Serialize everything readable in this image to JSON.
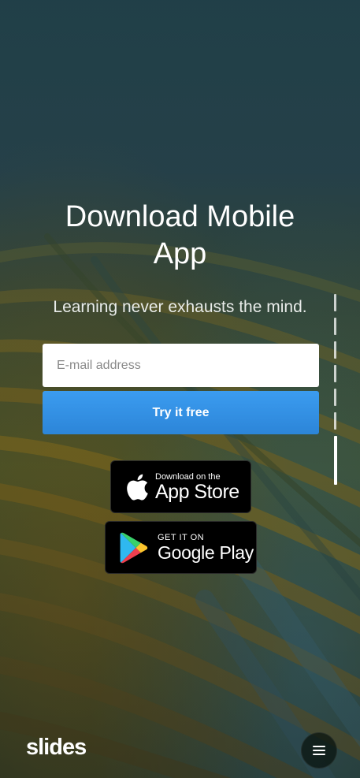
{
  "hero": {
    "title_line1": "Download Mobile",
    "title_line2": "App",
    "subtitle": "Learning never exhausts the mind."
  },
  "signup": {
    "email_placeholder": "E-mail address",
    "email_value": "",
    "submit_label": "Try it free",
    "submit_color": "#2f8fe3"
  },
  "stores": {
    "app_store": {
      "small": "Download on the",
      "big": "App Store"
    },
    "google_play": {
      "small": "GET IT ON",
      "big": "Google Play"
    }
  },
  "pagination": {
    "slides": 7,
    "active_index": 6
  },
  "footer": {
    "logo": "slides",
    "menu_icon": "hamburger-icon"
  }
}
